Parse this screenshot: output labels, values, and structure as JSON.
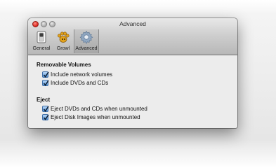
{
  "window": {
    "title": "Advanced"
  },
  "toolbar": {
    "items": [
      {
        "label": "General",
        "icon": "general-switch-icon",
        "selected": false
      },
      {
        "label": "Growl",
        "icon": "growl-paw-icon",
        "selected": false
      },
      {
        "label": "Advanced",
        "icon": "gear-icon",
        "selected": true
      }
    ]
  },
  "sections": [
    {
      "heading": "Removable Volumes",
      "options": [
        {
          "label": "Include network volumes",
          "checked": true
        },
        {
          "label": "Include DVDs and CDs",
          "checked": true
        }
      ]
    },
    {
      "heading": "Eject",
      "options": [
        {
          "label": "Eject DVDs and CDs when unmounted",
          "checked": true
        },
        {
          "label": "Eject Disk Images when unmounted",
          "checked": true
        }
      ]
    }
  ],
  "colors": {
    "checkbox_accent": "#5a97d9",
    "close_button": "#d8221b"
  }
}
